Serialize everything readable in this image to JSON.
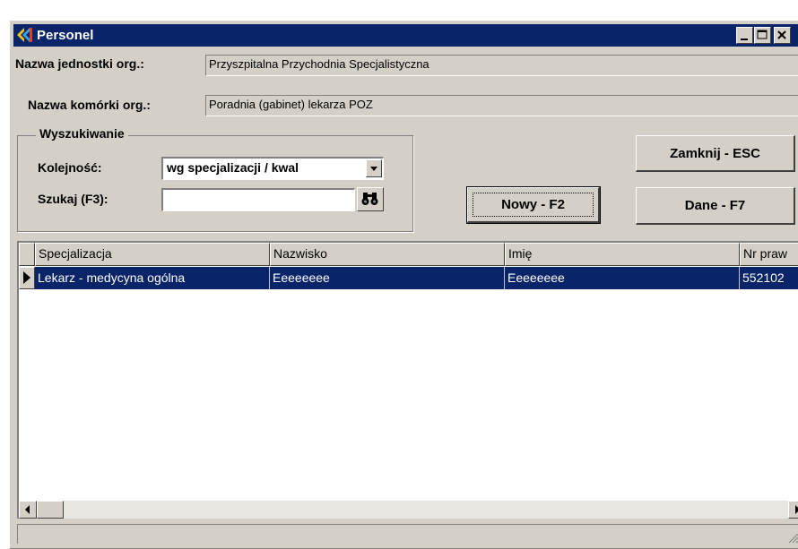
{
  "window": {
    "title": "Personel"
  },
  "org_unit": {
    "label": "Nazwa jednostki org.:",
    "value": "Przyszpitalna Przychodnia Specjalistyczna"
  },
  "org_cell": {
    "label": "Nazwa komórki org.:",
    "value": "Poradnia (gabinet) lekarza POZ"
  },
  "search": {
    "group_title": "Wyszukiwanie",
    "order_label": "Kolejność:",
    "order_value": "wg specjalizacji / kwal",
    "find_label": "Szukaj (F3):",
    "find_value": ""
  },
  "buttons": {
    "close": "Zamknij - ESC",
    "new": "Nowy - F2",
    "data": "Dane - F7"
  },
  "table": {
    "columns": [
      "Specjalizacja",
      "Nazwisko",
      "Imię",
      "Nr praw"
    ],
    "rows": [
      [
        "Lekarz - medycyna ogólna",
        "Eeeeeeee",
        "Eeeeeeee",
        "552102"
      ]
    ]
  },
  "colors": {
    "titlebar": "#0a246a",
    "selection": "#0a246a",
    "face": "#d4d0c8"
  }
}
